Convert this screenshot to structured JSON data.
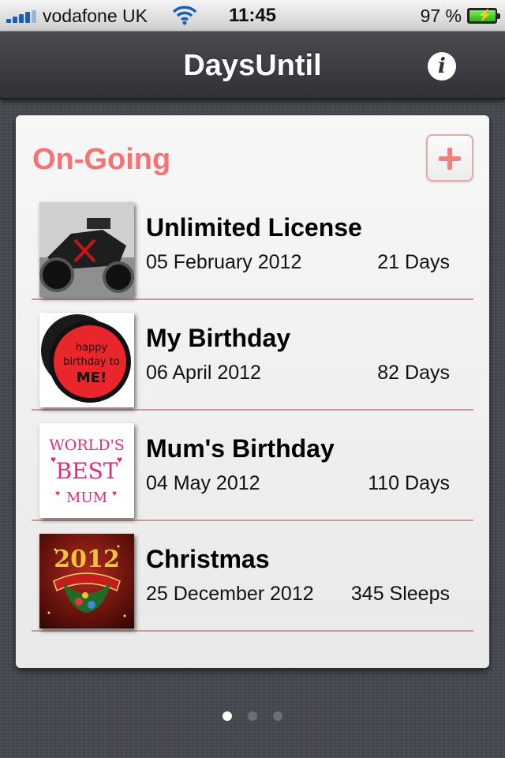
{
  "status_bar": {
    "carrier": "vodafone UK",
    "time": "11:45",
    "battery_percent": "97 %",
    "battery_level": 0.97
  },
  "navbar": {
    "title": "DaysUntil",
    "info_label": "i"
  },
  "section": {
    "title": "On-Going"
  },
  "events": [
    {
      "name": "Unlimited License",
      "date": "05 February 2012",
      "count": "21 Days",
      "thumb": "motorcycle"
    },
    {
      "name": "My Birthday",
      "date": "06 April 2012",
      "count": "82 Days",
      "thumb": "birthday-badge"
    },
    {
      "name": "Mum's Birthday",
      "date": "04 May 2012",
      "count": "110 Days",
      "thumb": "worlds-best-mum"
    },
    {
      "name": "Christmas",
      "date": "25 December 2012",
      "count": "345 Sleeps",
      "thumb": "christmas-2012"
    }
  ],
  "thumb_text": {
    "birthday": [
      "happy",
      "birthday to",
      "ME!"
    ],
    "mum": [
      "WORLD'S",
      "BEST",
      "MUM"
    ],
    "xmas": "2012"
  },
  "pager": {
    "pages": 3,
    "active": 1
  },
  "colors": {
    "accent": "#f47373",
    "separator": "#c99a9a",
    "navbar": "#3a3c41"
  }
}
